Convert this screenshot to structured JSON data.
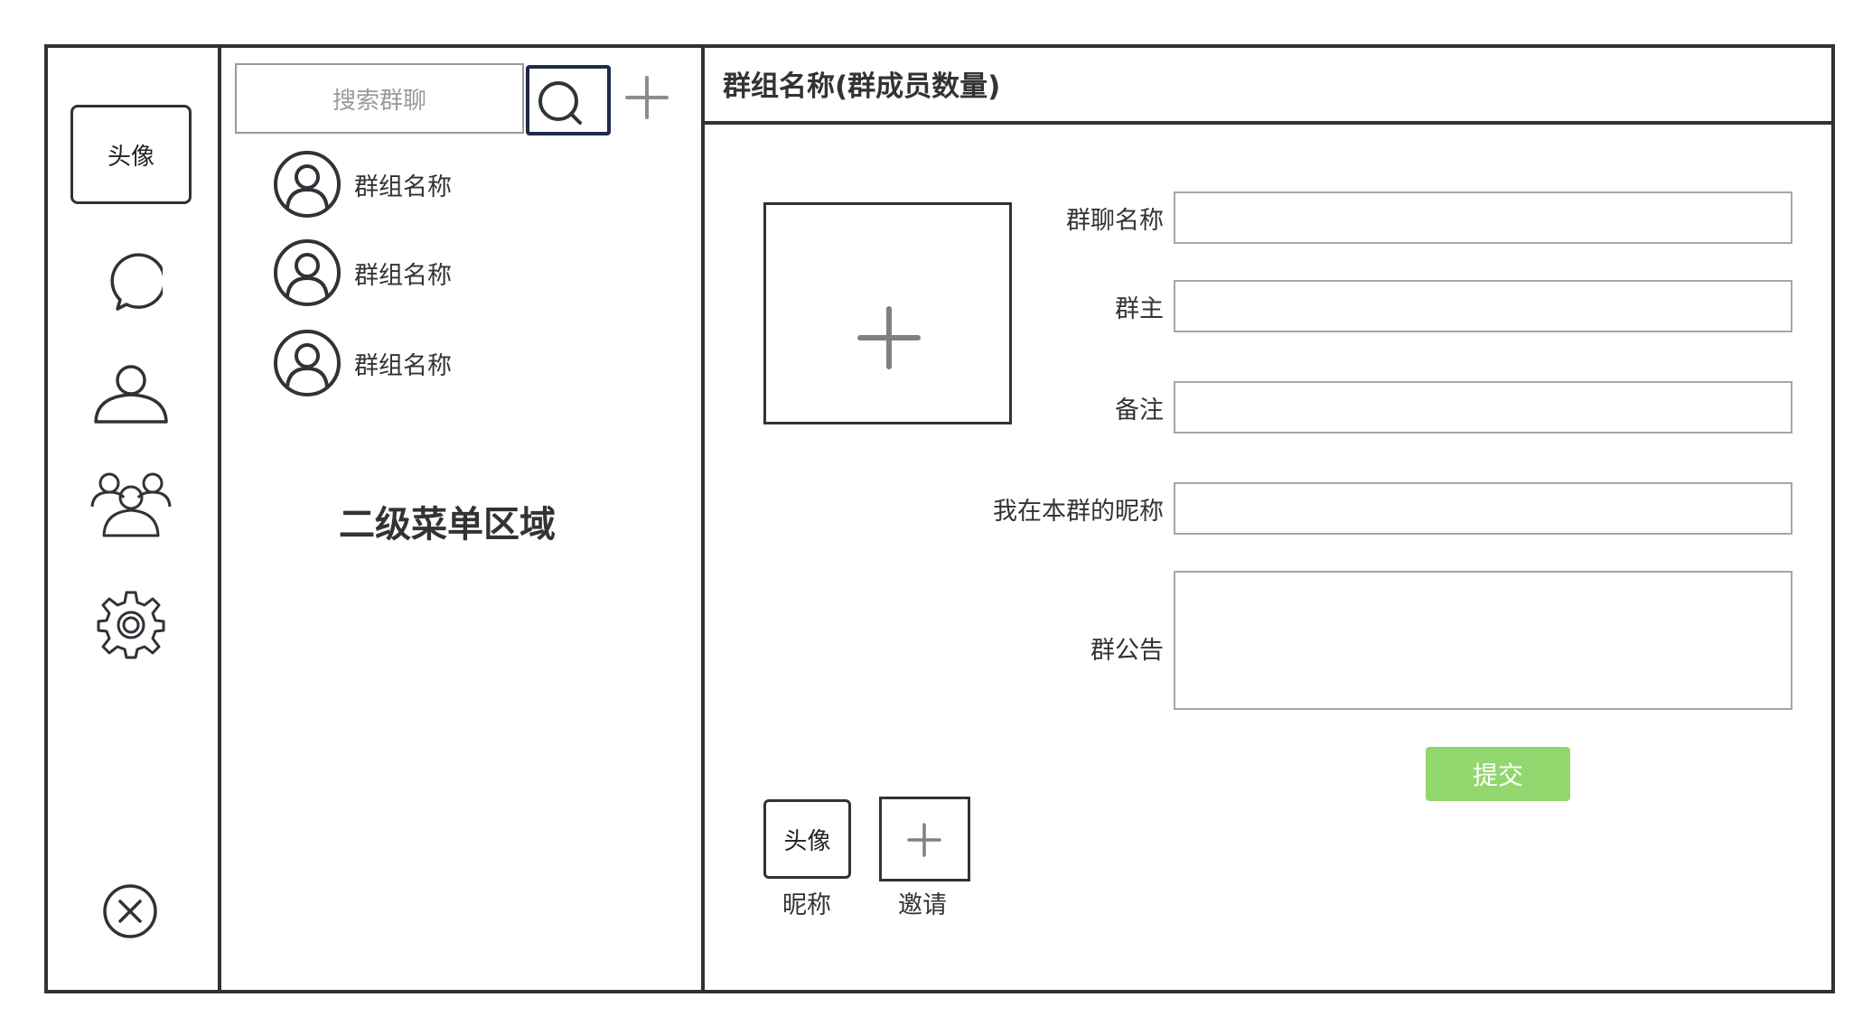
{
  "sidebar": {
    "avatar_label": "头像",
    "icons": [
      "chat-icon",
      "contact-icon",
      "group-icon",
      "settings-icon",
      "close-icon"
    ]
  },
  "secondary": {
    "search_placeholder": "搜索群聊",
    "groups": [
      {
        "name": "群组名称"
      },
      {
        "name": "群组名称"
      },
      {
        "name": "群组名称"
      }
    ],
    "area_label": "二级菜单区域"
  },
  "main": {
    "title": "群组名称(群成员数量)",
    "fields": {
      "group_name_label": "群聊名称",
      "owner_label": "群主",
      "remark_label": "备注",
      "nickname_label": "我在本群的昵称",
      "notice_label": "群公告"
    },
    "submit_label": "提交",
    "member": {
      "avatar_label": "头像",
      "caption": "昵称"
    },
    "invite_caption": "邀请"
  },
  "colors": {
    "border": "#2f3338",
    "submit": "#92d76e",
    "search_button": "#1f2a4a"
  }
}
